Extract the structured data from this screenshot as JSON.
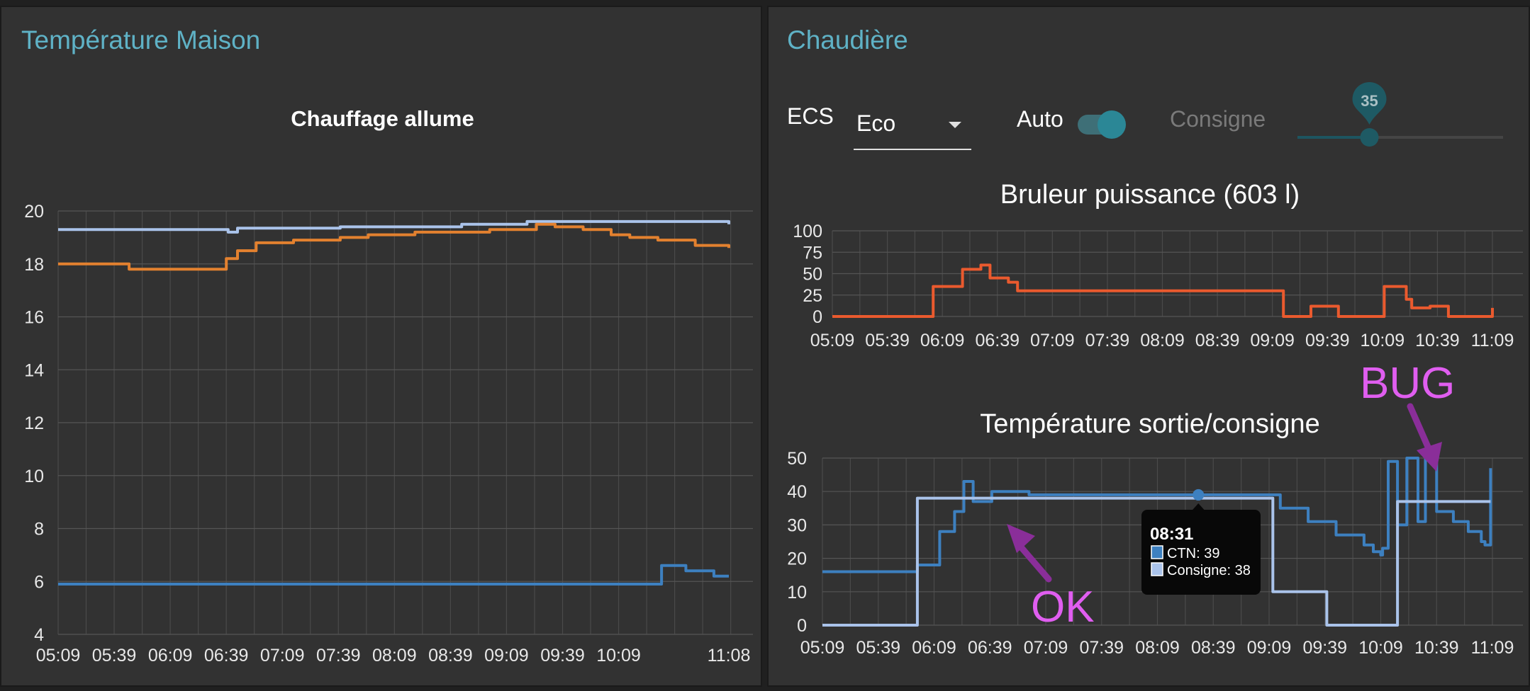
{
  "left_panel": {
    "title": "Température Maison",
    "chart_title": "Chauffage allume"
  },
  "right_panel": {
    "title": "Chaudière",
    "controls": {
      "ecs_label": "ECS",
      "ecs_value": "Eco",
      "auto_label": "Auto",
      "auto_on": true,
      "consigne_label": "Consigne",
      "consigne_value": "35",
      "consigne_fraction": 0.35
    },
    "annotations": {
      "bug": "BUG",
      "ok": "OK"
    }
  },
  "colors": {
    "panel_title": "#5fb2c6",
    "light_blue": "#aac3ea",
    "orange": "#e3812f",
    "blue": "#3d80c0",
    "red_orange": "#ea5a2e",
    "magenta": "#e05ef0",
    "purple_arrow": "#8a2e99"
  },
  "chart_data": [
    {
      "type": "line",
      "title": "Chauffage allume",
      "ylim": [
        4,
        20
      ],
      "yticks": [
        "4",
        "6",
        "8",
        "10",
        "12",
        "14",
        "16",
        "18",
        "20"
      ],
      "xticks": [
        "05:09",
        "05:39",
        "06:09",
        "06:39",
        "07:09",
        "07:39",
        "08:09",
        "08:39",
        "09:09",
        "09:39",
        "10:09",
        "11:08"
      ],
      "grid": true,
      "series": [
        {
          "color": "#aac3ea",
          "x": [
            "05:09",
            "06:20",
            "06:40",
            "06:45",
            "07:40",
            "08:45",
            "09:20",
            "09:45",
            "10:30",
            "11:08"
          ],
          "y": [
            19.3,
            19.3,
            19.2,
            19.35,
            19.4,
            19.5,
            19.6,
            19.6,
            19.6,
            19.5
          ]
        },
        {
          "color": "#e3812f",
          "x": [
            "05:09",
            "05:27",
            "05:47",
            "06:24",
            "06:39",
            "06:45",
            "06:55",
            "07:15",
            "07:40",
            "07:55",
            "08:20",
            "09:00",
            "09:25",
            "09:35",
            "09:50",
            "10:05",
            "10:15",
            "10:30",
            "10:50",
            "11:08"
          ],
          "y": [
            18.0,
            18.0,
            17.8,
            17.8,
            18.2,
            18.5,
            18.8,
            18.9,
            19.0,
            19.1,
            19.2,
            19.3,
            19.5,
            19.4,
            19.3,
            19.1,
            19.0,
            18.9,
            18.7,
            18.6
          ]
        },
        {
          "color": "#3d80c0",
          "x": [
            "05:09",
            "10:30",
            "10:32",
            "10:45",
            "10:58",
            "11:00",
            "11:08"
          ],
          "y": [
            5.9,
            5.9,
            6.6,
            6.4,
            6.4,
            6.2,
            6.2
          ]
        }
      ]
    },
    {
      "type": "line",
      "title": "Bruleur puissance (603 l)",
      "ylim": [
        0,
        100
      ],
      "yticks": [
        "0",
        "25",
        "50",
        "75",
        "100"
      ],
      "xticks": [
        "05:09",
        "05:39",
        "06:09",
        "06:39",
        "07:09",
        "07:39",
        "08:09",
        "08:39",
        "09:09",
        "09:39",
        "10:09",
        "10:39",
        "11:09"
      ],
      "grid": true,
      "series": [
        {
          "color": "#ea5a2e",
          "x": [
            "05:09",
            "06:01",
            "06:04",
            "06:15",
            "06:20",
            "06:30",
            "06:35",
            "06:45",
            "06:50",
            "09:10",
            "09:15",
            "09:25",
            "09:30",
            "09:35",
            "09:45",
            "10:01",
            "10:10",
            "10:15",
            "10:22",
            "10:25",
            "10:35",
            "10:45",
            "10:50",
            "11:08",
            "11:09"
          ],
          "y": [
            0,
            0,
            35,
            35,
            55,
            60,
            45,
            40,
            30,
            30,
            0,
            0,
            12,
            12,
            0,
            0,
            35,
            35,
            20,
            10,
            12,
            0,
            0,
            0,
            10
          ]
        }
      ]
    },
    {
      "type": "line",
      "title": "Température sortie/consigne",
      "ylim": [
        0,
        50
      ],
      "yticks": [
        "0",
        "10",
        "20",
        "30",
        "40",
        "50"
      ],
      "xticks": [
        "05:09",
        "05:39",
        "06:09",
        "06:39",
        "07:09",
        "07:39",
        "08:09",
        "08:39",
        "09:09",
        "09:39",
        "10:09",
        "10:39",
        "11:09"
      ],
      "grid": true,
      "tooltip": {
        "time": "08:31",
        "rows": [
          "CTN: 39",
          "Consigne: 38"
        ]
      },
      "series": [
        {
          "name": "CTN",
          "color": "#3d80c0",
          "x": [
            "05:09",
            "05:59",
            "06:00",
            "06:10",
            "06:12",
            "06:20",
            "06:25",
            "06:30",
            "06:40",
            "07:00",
            "08:30",
            "09:10",
            "09:15",
            "09:30",
            "09:45",
            "10:00",
            "10:05",
            "10:09",
            "10:10",
            "10:13",
            "10:18",
            "10:23",
            "10:29",
            "10:33",
            "10:39",
            "10:48",
            "10:56",
            "11:03",
            "11:05",
            "11:08"
          ],
          "y": [
            16,
            16,
            18,
            18,
            28,
            34,
            43,
            37,
            40,
            39,
            39,
            39,
            35,
            31,
            27,
            24,
            22,
            21,
            23,
            49,
            30,
            50,
            31,
            50,
            34,
            31,
            28,
            25,
            24,
            47
          ]
        },
        {
          "name": "Consigne",
          "color": "#aac3ea",
          "x": [
            "05:09",
            "05:59",
            "06:00",
            "09:10",
            "09:11",
            "09:39",
            "09:40",
            "10:17",
            "10:18",
            "11:03",
            "11:04",
            "11:08"
          ],
          "y": [
            0,
            0,
            38,
            38,
            10,
            10,
            0,
            0,
            37,
            37,
            37,
            37
          ]
        }
      ]
    }
  ]
}
